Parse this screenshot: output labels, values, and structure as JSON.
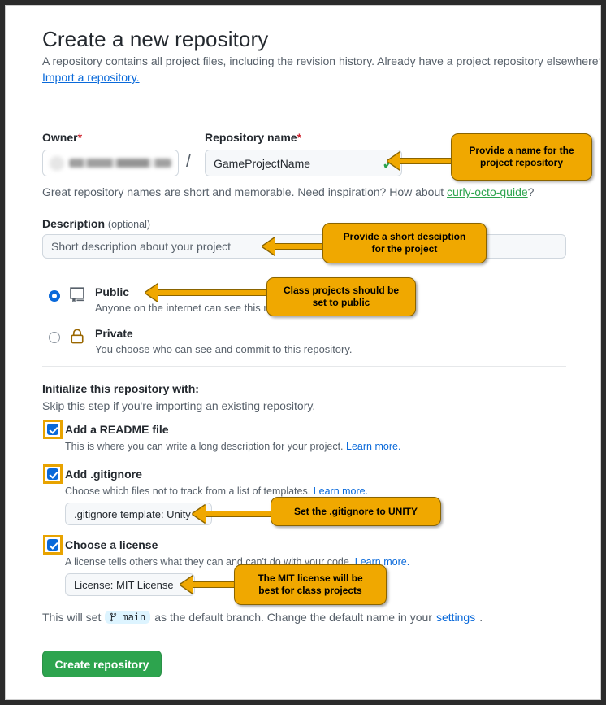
{
  "header": {
    "title": "Create a new repository",
    "subtitle": "A repository contains all project files, including the revision history. Already have a project repository elsewhere?",
    "import_link": "Import a repository."
  },
  "owner": {
    "label": "Owner",
    "required_mark": "*",
    "value_redacted": true
  },
  "repository": {
    "label": "Repository name",
    "required_mark": "*",
    "value": "GameProjectName",
    "valid_icon": "check-icon",
    "separator": "/",
    "hint_prefix": "Great repository names are short and memorable. Need inspiration? How about ",
    "hint_suggestion": "curly-octo-guide",
    "hint_suffix": "?"
  },
  "description": {
    "label": "Description",
    "optional_label": "(optional)",
    "value": "Short description about your project"
  },
  "visibility": {
    "public": {
      "title": "Public",
      "description": "Anyone on the internet can see this repository.",
      "selected": true,
      "icon": "book-icon"
    },
    "private": {
      "title": "Private",
      "description": "You choose who can see and commit to this repository.",
      "selected": false,
      "icon": "lock-icon"
    }
  },
  "initialize": {
    "heading": "Initialize this repository with:",
    "subheading": "Skip this step if you're importing an existing repository.",
    "readme": {
      "title": "Add a README file",
      "description": "This is where you can write a long description for your project.",
      "learn_more": "Learn more.",
      "checked": true
    },
    "gitignore": {
      "title": "Add .gitignore",
      "description": "Choose which files not to track from a list of templates.",
      "learn_more": "Learn more.",
      "checked": true,
      "dropdown_label": ".gitignore template: Unity"
    },
    "license": {
      "title": "Choose a license",
      "description": "A license tells others what they can and can't do with your code.",
      "learn_more": "Learn more.",
      "checked": true,
      "dropdown_label": "License: MIT License"
    }
  },
  "branch": {
    "prefix": "This will set",
    "name": "main",
    "middle": "as the default branch. Change the default name in your",
    "settings_link": "settings",
    "suffix": "."
  },
  "actions": {
    "create_label": "Create repository"
  },
  "annotations": [
    {
      "id": "name-callout",
      "text": "Provide a name for the\nproject repository"
    },
    {
      "id": "description-callout",
      "text": "Provide a short desciption\nfor the project"
    },
    {
      "id": "public-callout",
      "text": "Class projects should be\nset to public"
    },
    {
      "id": "gitignore-callout",
      "text": "Set the .gitignore to UNITY"
    },
    {
      "id": "license-callout",
      "text": "The MIT license will be\nbest for class projects"
    }
  ],
  "colors": {
    "annotation_bg": "#f0a800",
    "primary_button": "#2da44e",
    "link": "#0969da",
    "green_link": "#2da44e",
    "required": "#cf222e",
    "highlight_box": "#e8a300"
  }
}
